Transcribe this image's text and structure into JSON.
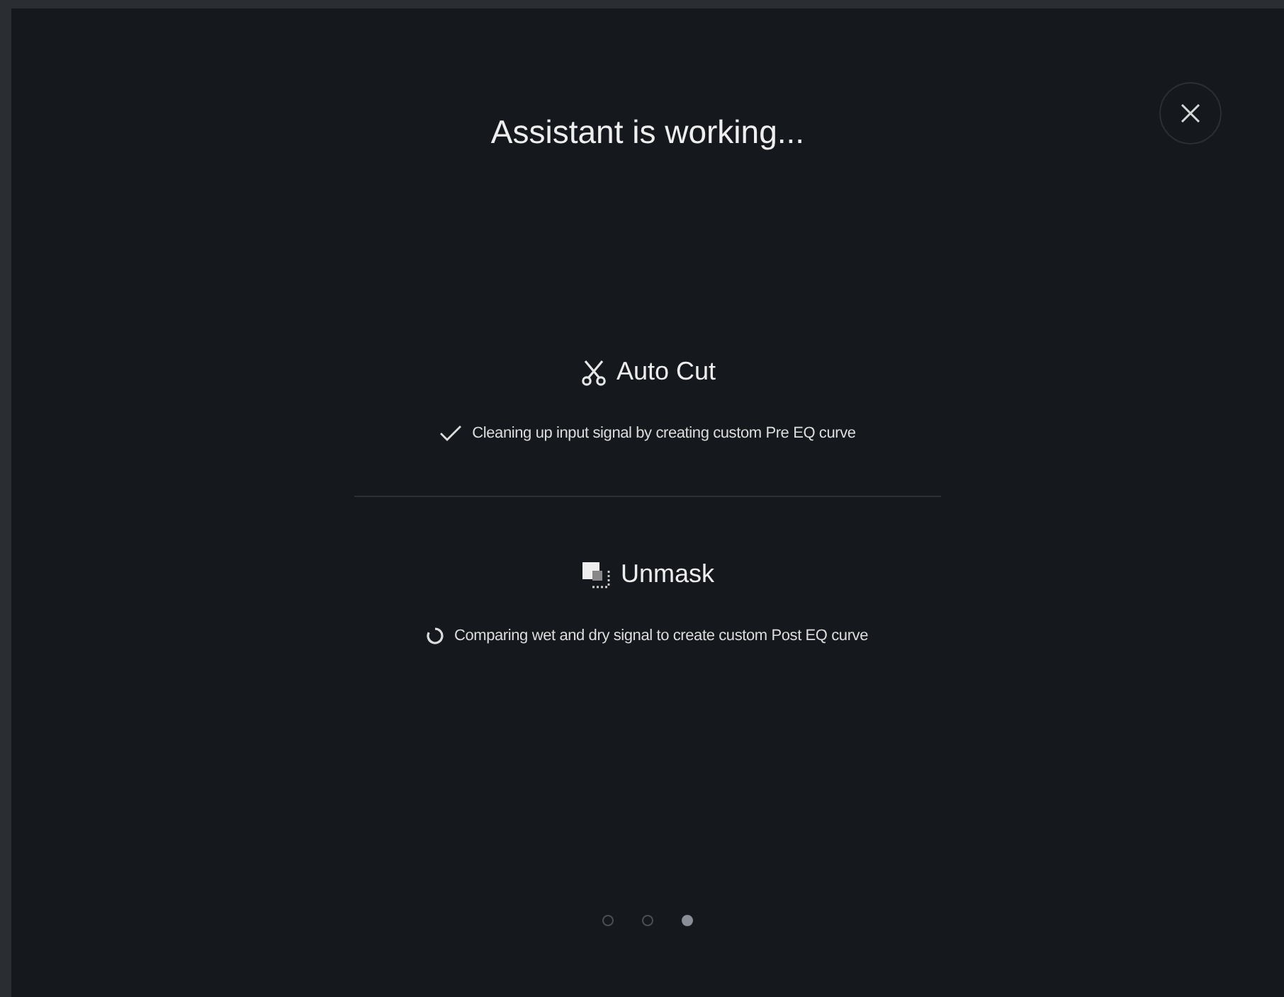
{
  "dialog": {
    "title": "Assistant is working...",
    "steps": [
      {
        "kind": "cut",
        "title": "Auto Cut",
        "complete": true,
        "description": "Cleaning up input signal by creating custom Pre EQ curve"
      },
      {
        "kind": "unmask",
        "title": "Unmask",
        "complete": false,
        "description": "Comparing wet and dry signal to create custom Post EQ curve"
      }
    ],
    "pages": [
      {
        "selected": false
      },
      {
        "selected": false
      },
      {
        "selected": true
      }
    ]
  }
}
